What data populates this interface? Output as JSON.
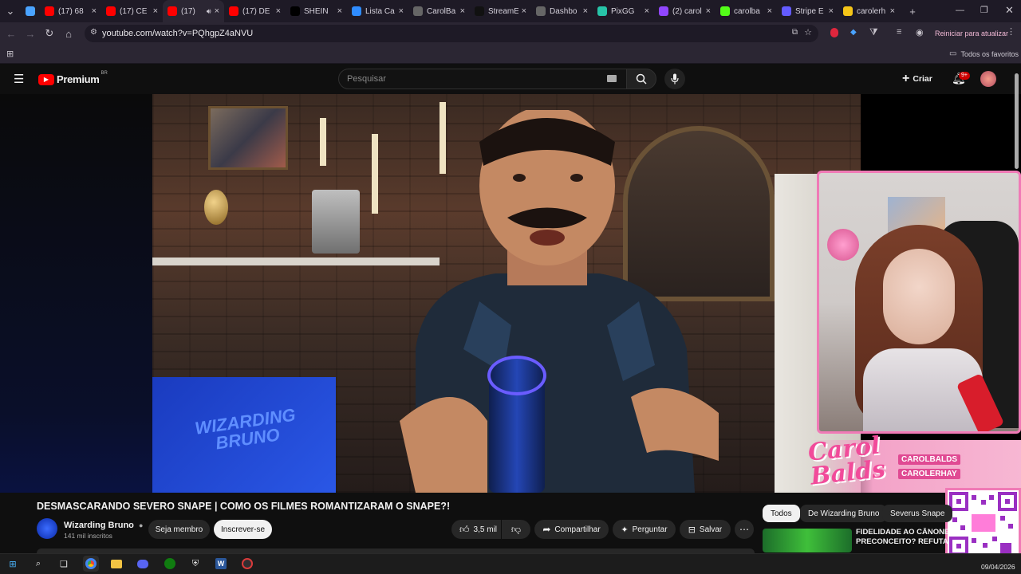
{
  "browser": {
    "tabs": [
      {
        "label": "",
        "favicon": "gem-icon",
        "color": "#4aa3ff",
        "active": false
      },
      {
        "label": "(17) 68",
        "favicon": "youtube-icon",
        "color": "#ff0000",
        "active": false
      },
      {
        "label": "(17) CE",
        "favicon": "youtube-icon",
        "color": "#ff0000",
        "active": false
      },
      {
        "label": "(17)",
        "favicon": "youtube-icon",
        "color": "#ff0000",
        "active": true
      },
      {
        "label": "(17) DE",
        "favicon": "youtube-icon",
        "color": "#ff0000",
        "active": false
      },
      {
        "label": "SHEIN",
        "favicon": "shein-icon",
        "color": "#000000",
        "active": false
      },
      {
        "label": "Lista Ca",
        "favicon": "cloud-icon",
        "color": "#2f8cff",
        "active": false
      },
      {
        "label": "CarolBa",
        "favicon": "globe-icon",
        "color": "#666666",
        "active": false
      },
      {
        "label": "StreamE",
        "favicon": "streamelements-icon",
        "color": "#111111",
        "active": false
      },
      {
        "label": "Dashbo",
        "favicon": "globe-icon",
        "color": "#666666",
        "active": false
      },
      {
        "label": "PixGG",
        "favicon": "pixgg-icon",
        "color": "#27c4a8",
        "active": false
      },
      {
        "label": "(2) carol",
        "favicon": "twitch-icon",
        "color": "#9146ff",
        "active": false
      },
      {
        "label": "carolba",
        "favicon": "kick-icon",
        "color": "#53fc18",
        "active": false
      },
      {
        "label": "Stripe E",
        "favicon": "stripe-icon",
        "color": "#635bff",
        "active": false
      },
      {
        "label": "carolerh",
        "favicon": "bolt-icon",
        "color": "#f5c518",
        "active": false
      }
    ],
    "new_tab_label": "+",
    "url": "youtube.com/watch?v=PQhgpZ4aNVU",
    "restart_label": "Reiniciar para atualizar",
    "bookmarks_label": "Todos os favoritos"
  },
  "youtube": {
    "logo_label": "Premium",
    "region": "BR",
    "search_placeholder": "Pesquisar",
    "create_label": "Criar",
    "notifications_badge": "9+"
  },
  "video": {
    "title": "DESMASCARANDO SEVERO SNAPE | COMO OS FILMES ROMANTIZARAM O SNAPE?!",
    "screen_text": "WIZARDING BRUNO",
    "channel_name": "Wizarding Bruno",
    "subscribers": "141 mil inscritos",
    "join_label": "Seja membro",
    "subscribe_label": "Inscrever-se",
    "likes": "3,5 mil",
    "share_label": "Compartilhar",
    "ask_label": "Perguntar",
    "save_label": "Salvar"
  },
  "overlay": {
    "brand": "Carol Balds",
    "handle_1": "CAROLBALDS",
    "handle_2": "CAROLERHAY"
  },
  "chips": [
    "Todos",
    "De Wizarding Bruno",
    "Severus Snape"
  ],
  "recommendation": {
    "title_line_1": "FIDELIDADE AO CÂNONE V",
    "title_line_2": "PRECONCEITO? REFUTAN"
  },
  "taskbar": {
    "date": "09/04/2026"
  }
}
